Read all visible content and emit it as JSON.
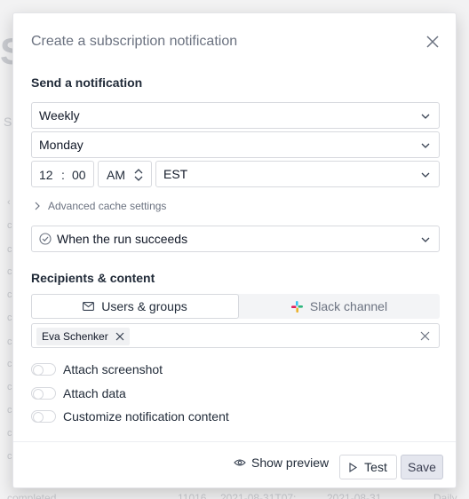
{
  "background": {
    "title_fragment": "S",
    "subtitle_fragment": "S",
    "row": {
      "status": "completed",
      "id": "11016",
      "date1": "2021-08-31T07:",
      "date2": "2021-08-31",
      "type": "Daily"
    }
  },
  "modal": {
    "title": "Create a subscription notification",
    "send_label": "Send a notification",
    "frequency": "Weekly",
    "day": "Monday",
    "time": {
      "hour": "12",
      "separator": ":",
      "minute": "00",
      "period": "AM",
      "timezone": "EST"
    },
    "advanced_label": "Advanced cache settings",
    "condition": "When the run succeeds",
    "recipients_label": "Recipients & content",
    "tabs": [
      {
        "label": "Users & groups",
        "icon": "mail-icon",
        "active": true
      },
      {
        "label": "Slack channel",
        "icon": "slack-icon",
        "active": false
      }
    ],
    "recipients": [
      "Eva Schenker"
    ],
    "toggles": [
      {
        "label": "Attach screenshot",
        "on": false
      },
      {
        "label": "Attach data",
        "on": false
      },
      {
        "label": "Customize notification content",
        "on": false
      }
    ],
    "footer": {
      "preview_label": "Show preview",
      "test_label": "Test",
      "save_label": "Save"
    }
  }
}
